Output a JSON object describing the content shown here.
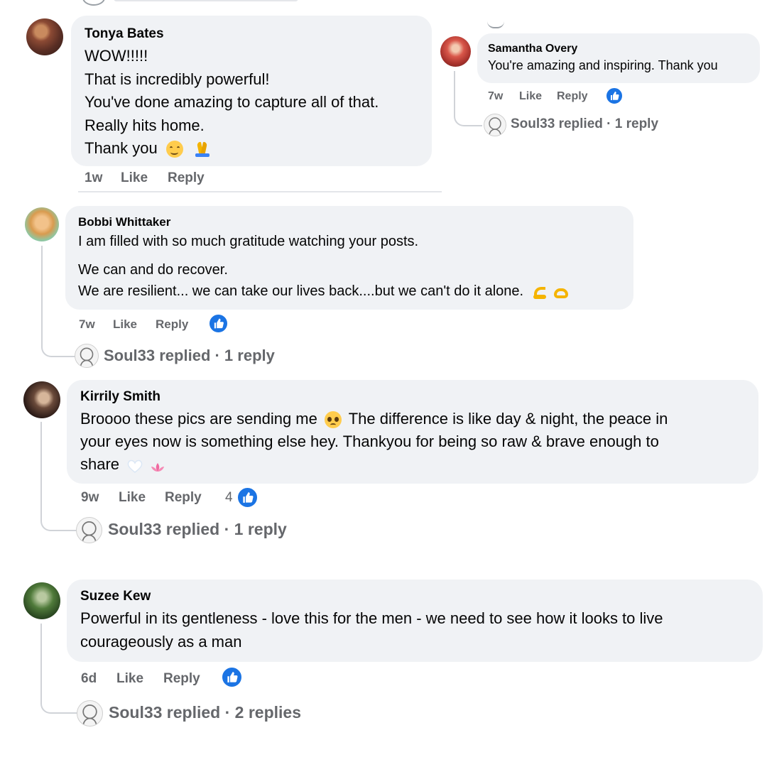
{
  "comments": [
    {
      "id": "tonya",
      "name": "Tonya Bates",
      "lines": [
        "WOW!!!!!",
        "That is incredibly powerful!",
        "You've done amazing to capture all of that.",
        "Really hits home.",
        "Thank you"
      ],
      "time": "1w",
      "like": "Like",
      "reply": "Reply"
    },
    {
      "id": "samantha",
      "name": "Samantha Overy",
      "lines": [
        "You're amazing and inspiring. Thank you"
      ],
      "time": "7w",
      "like": "Like",
      "reply": "Reply",
      "replied_text": "Soul33 replied · 1 reply"
    },
    {
      "id": "bobbi",
      "name": "Bobbi Whittaker",
      "lines": [
        "I am filled with so much gratitude watching your posts.",
        "We can and do recover.",
        "We are resilient... we can take our lives back....but we can't do it alone."
      ],
      "time": "7w",
      "like": "Like",
      "reply": "Reply",
      "replied_text": "Soul33 replied · 1 reply"
    },
    {
      "id": "kirrily",
      "name": "Kirrily Smith",
      "lines": [
        "Broooo these pics are sending me",
        "The difference is like day & night, the peace in",
        "your eyes now is something else hey. Thankyou for being so raw & brave enough to",
        "share"
      ],
      "time": "9w",
      "like": "Like",
      "reply": "Reply",
      "reaction_count": "4",
      "replied_text": "Soul33 replied · 1 reply"
    },
    {
      "id": "suzee",
      "name": "Suzee Kew",
      "lines": [
        "Powerful in its gentleness - love this for the men - we need to see how it looks to live",
        "courageously as a man"
      ],
      "time": "6d",
      "like": "Like",
      "reply": "Reply",
      "replied_text": "Soul33 replied · 2 replies"
    }
  ],
  "icons": {
    "like_reaction": "like-reaction-icon",
    "replier_avatar": "soul33-avatar"
  },
  "colors": {
    "bubble": "#f0f2f5",
    "meta_text": "#65676b",
    "like_blue": "#1b74e4",
    "thread_line": "#d0d3d8"
  }
}
